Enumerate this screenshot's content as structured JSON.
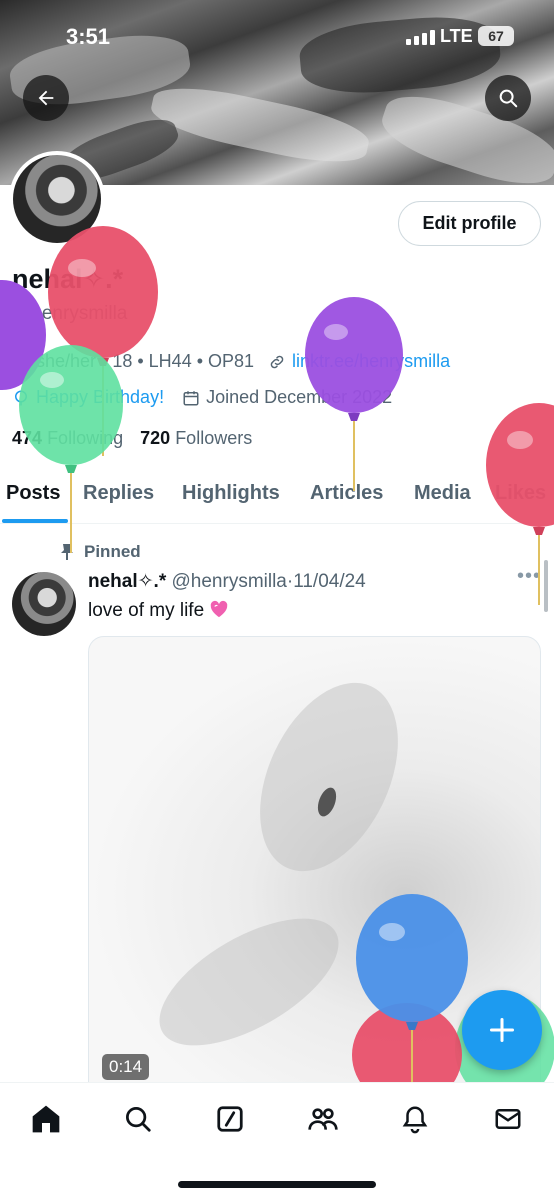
{
  "status_bar": {
    "time": "3:51",
    "network": "LTE",
    "battery": "67"
  },
  "profile": {
    "name": "nehal✧.*",
    "handle": "@henrysmilla",
    "edit_button": "Edit profile",
    "location": "she/her • 18 • LH44 • OP81",
    "link": "linktr.ee/henrysmilla",
    "birthday": "Happy Birthday!",
    "joined": "Joined December 2022",
    "following_count": "474",
    "following_label": "Following",
    "followers_count": "720",
    "followers_label": "Followers"
  },
  "tabs": [
    "Posts",
    "Replies",
    "Highlights",
    "Articles",
    "Media",
    "Likes"
  ],
  "pinned_post": {
    "pinned_label": "Pinned",
    "author_name": "nehal✧.*",
    "author_handle": "@henrysmilla",
    "separator": "·",
    "date": "11/04/24",
    "text": "love of my life",
    "video_duration": "0:14"
  },
  "bottom_nav": [
    "home-icon",
    "search-icon",
    "grok-icon",
    "communities-icon",
    "notifications-icon",
    "messages-icon"
  ],
  "colors": {
    "accent": "#1d9bf0",
    "text": "#0f1419",
    "secondary": "#536471"
  },
  "balloon_colors": [
    "#e8506a",
    "#9b4fe0",
    "#5ee0a0",
    "#4a90e8"
  ]
}
